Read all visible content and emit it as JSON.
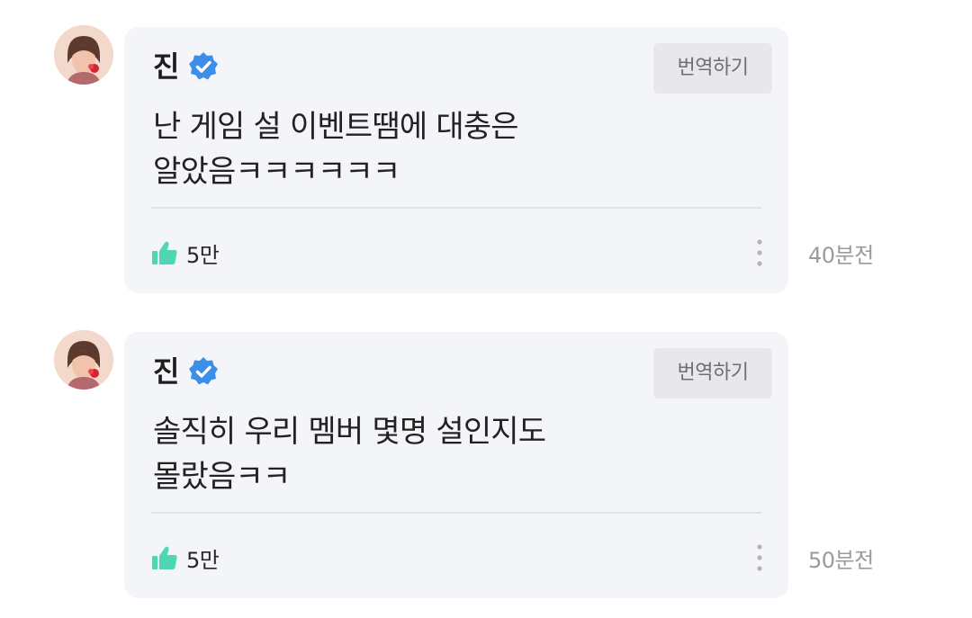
{
  "colors": {
    "verified": "#3d8ee9",
    "like": "#4fd6b4",
    "bubble_background": "#f4f5f9",
    "translate_background": "#e8e8eb"
  },
  "icons": {
    "verified": "verified-check-icon",
    "like": "thumbs-up-icon",
    "more": "vertical-dots-icon"
  },
  "comments": [
    {
      "author": "진",
      "translate_label": "번역하기",
      "text": "난 게임 설 이벤트땜에 대충은\n알았음ㅋㅋㅋㅋㅋㅋ",
      "like_count": "5만",
      "timestamp": "40분전"
    },
    {
      "author": "진",
      "translate_label": "번역하기",
      "text": "솔직히 우리 멤버 몇명 설인지도\n몰랐음ㅋㅋ",
      "like_count": "5만",
      "timestamp": "50분전"
    }
  ]
}
